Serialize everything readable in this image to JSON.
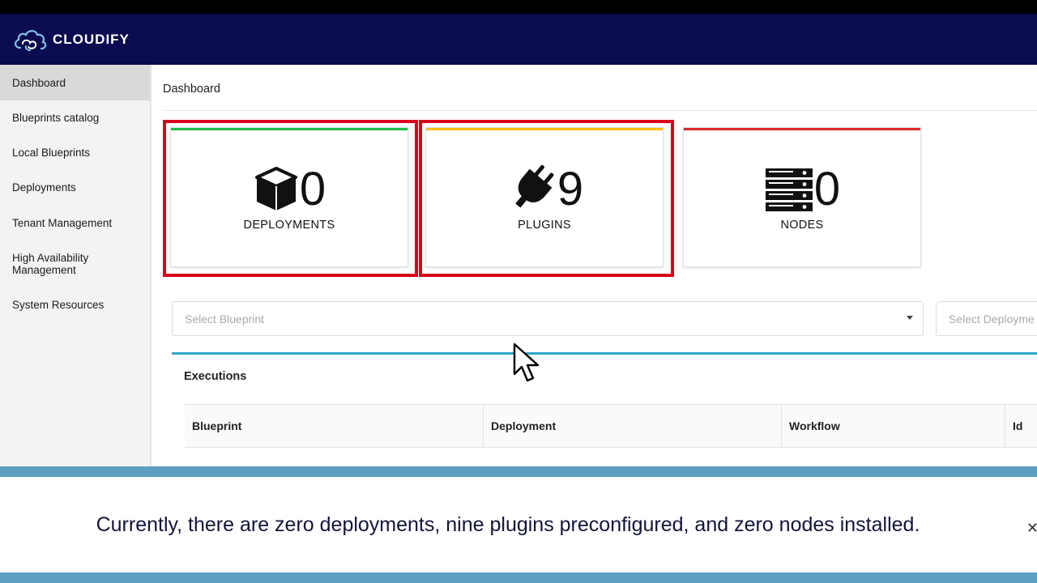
{
  "app": {
    "brand": "CLOUDIFY",
    "logo_icon": "cloud-logo-icon"
  },
  "sidebar": {
    "items": [
      {
        "label": "Dashboard",
        "active": true
      },
      {
        "label": "Blueprints catalog"
      },
      {
        "label": "Local Blueprints"
      },
      {
        "label": "Deployments"
      },
      {
        "label": "Tenant Management"
      },
      {
        "label": "High Availability Management"
      },
      {
        "label": "System Resources"
      }
    ]
  },
  "breadcrumb": "Dashboard",
  "tiles": [
    {
      "icon": "cube-icon",
      "value": "0",
      "label": "DEPLOYMENTS",
      "accent": "#21ba45"
    },
    {
      "icon": "plug-icon",
      "value": "9",
      "label": "PLUGINS",
      "accent": "#fbbd08"
    },
    {
      "icon": "server-stack-icon",
      "value": "0",
      "label": "NODES",
      "accent": "#db2828"
    }
  ],
  "filters": {
    "blueprint_placeholder": "Select Blueprint",
    "deployment_placeholder": "Select Deployme"
  },
  "executions": {
    "title": "Executions",
    "columns": [
      "Blueprint",
      "Deployment",
      "Workflow",
      "Id"
    ]
  },
  "caption": {
    "text": "Currently, there are zero deployments, nine plugins preconfigured, and zero nodes installed.",
    "close_icon": "close-icon"
  },
  "colors": {
    "header_bg": "#0b0b4f",
    "highlight": "#d9001b",
    "executions_accent": "#2aa7c9",
    "caption_band": "#5c9fc2"
  }
}
